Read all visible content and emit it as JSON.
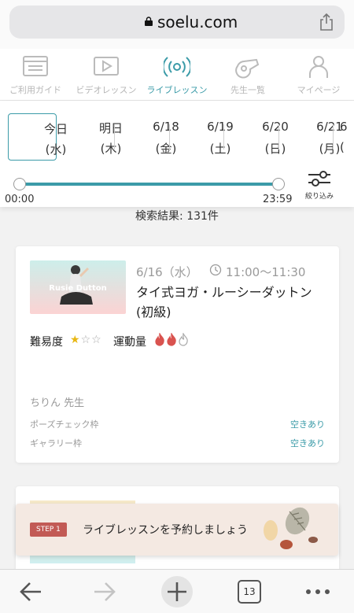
{
  "browser": {
    "url": "soelu.com",
    "tab_count": "13"
  },
  "nav": {
    "items": [
      {
        "label": "ご利用ガイド",
        "icon": "guide-icon"
      },
      {
        "label": "ビデオレッスン",
        "icon": "video-icon"
      },
      {
        "label": "ライブレッスン",
        "icon": "live-icon",
        "active": true
      },
      {
        "label": "先生一覧",
        "icon": "whistle-icon"
      },
      {
        "label": "マイページ",
        "icon": "person-icon"
      }
    ]
  },
  "dates": [
    {
      "day": "今日",
      "weekday": "(水)",
      "selected": true
    },
    {
      "day": "明日",
      "weekday": "(木)"
    },
    {
      "day": "6/18",
      "weekday": "(金)"
    },
    {
      "day": "6/19",
      "weekday": "(土)"
    },
    {
      "day": "6/20",
      "weekday": "(日)"
    },
    {
      "day": "6/21",
      "weekday": "(月)"
    },
    {
      "day": "6",
      "weekday": "("
    }
  ],
  "time_range": {
    "start": "00:00",
    "end": "23:59"
  },
  "filter_label": "絞り込み",
  "result_text": "検索結果: 131件",
  "lesson": {
    "thumb_text": "Rusie Dutton",
    "date": "6/16（水）",
    "time": "11:00〜11:30",
    "title": "タイ式ヨガ・ルーシーダットン(初級)",
    "difficulty_label": "難易度",
    "difficulty": 1,
    "difficulty_max": 3,
    "activity_label": "運動量",
    "activity": 2,
    "activity_max": 3,
    "teacher": "ちりん 先生",
    "pose_check_label": "ポーズチェック枠",
    "pose_check_value": "空きあり",
    "gallery_label": "ギャラリー枠",
    "gallery_value": "空きあり"
  },
  "banner": {
    "step": "STEP 1",
    "text": "ライブレッスンを予約しましょう"
  },
  "colors": {
    "accent": "#3b9ba8",
    "step": "#c25a55",
    "star": "#e8b713",
    "flame": "#d9534f"
  }
}
